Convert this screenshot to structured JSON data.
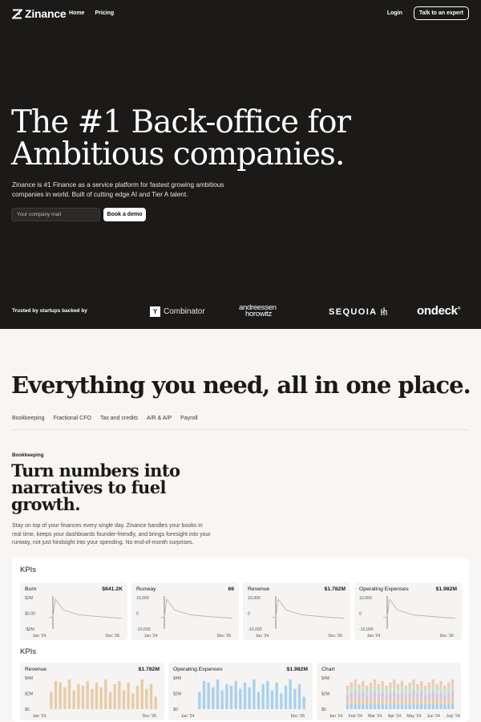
{
  "nav": {
    "brand": "Zinance",
    "links": [
      "Home",
      "Pricing"
    ],
    "login": "Login",
    "cta": "Talk to an expert"
  },
  "hero": {
    "headline_line1": "The #1 Back-office for",
    "headline_line2": "Ambitious companies.",
    "subtitle": "Zinance is #1 Finance as a service platform for fastest growing ambitious companies in world. Built of cutting edge AI and Tier A talent.",
    "email_placeholder": "Your company mail",
    "demo_button": "Book a demo",
    "trusted": "Trusted by startups backed by",
    "investor_logos": {
      "yc_mark": "Y",
      "yc_name": "Combinator",
      "a16z_line1": "andreessen",
      "a16z_line2": "horowitz",
      "sequoia": "SEQUOIA",
      "ondeck": "ondeck"
    }
  },
  "features": {
    "title": "Everything you need, all in one place.",
    "tabs": [
      "Bookkeeping",
      "Fractional CFO",
      "Tax and credits",
      "A/R & A/P",
      "Payroll"
    ],
    "eyebrow": "Bookkeeping",
    "heading": "Turn numbers into narratives to fuel growth.",
    "description": "Stay on top of your finances every single day. Zinance handles your books in real time, keeps your dashboards founder-friendly, and brings foresight into your runway, not just hindsight into your spending. No end-of-month surprises."
  },
  "dashboard": {
    "row1_title": "KPIs",
    "row2_title": "KPIs",
    "cards_row1": [
      {
        "label": "Burn",
        "value": "$641.2K",
        "yticks": [
          "$2M",
          "$0.00",
          "-$2M"
        ],
        "xticks": [
          "Jan '24",
          "Dec '26"
        ]
      },
      {
        "label": "Runway",
        "value": "66",
        "yticks": [
          "10,000",
          "0",
          "-10,000"
        ],
        "xticks": [
          "Jan '24",
          "Dec '26"
        ]
      },
      {
        "label": "Revenue",
        "value": "$1.782M",
        "yticks": [
          "10,000",
          "0",
          "-10,000"
        ],
        "xticks": [
          "Jan '24",
          "Dec '26"
        ]
      },
      {
        "label": "Operating Expenses",
        "value": "$1.982M",
        "yticks": [
          "10,000",
          "0",
          "-10,000"
        ],
        "xticks": [
          "Jan '24",
          "Dec '26"
        ]
      }
    ],
    "cards_row2": [
      {
        "label": "Revenue",
        "value": "$1.782M",
        "yticks": [
          "$4M",
          "$2M",
          "$0"
        ],
        "xticks": [
          "Jan '24",
          "Dec '26"
        ],
        "color": "#e8cba8"
      },
      {
        "label": "Operating Expenses",
        "value": "$1.982M",
        "yticks": [
          "$4M",
          "$2M",
          "$0"
        ],
        "xticks": [
          "Jan '24",
          "Dec '26"
        ],
        "color": "#a9d1ec"
      },
      {
        "label": "Chart",
        "value": "",
        "yticks": [
          "$4M",
          "$2M",
          "$0"
        ],
        "xticks": [
          "Jan '24",
          "Feb '24",
          "Mar '24",
          "Apr '24",
          "May '24",
          "Jun '24",
          "July '24"
        ]
      }
    ]
  }
}
